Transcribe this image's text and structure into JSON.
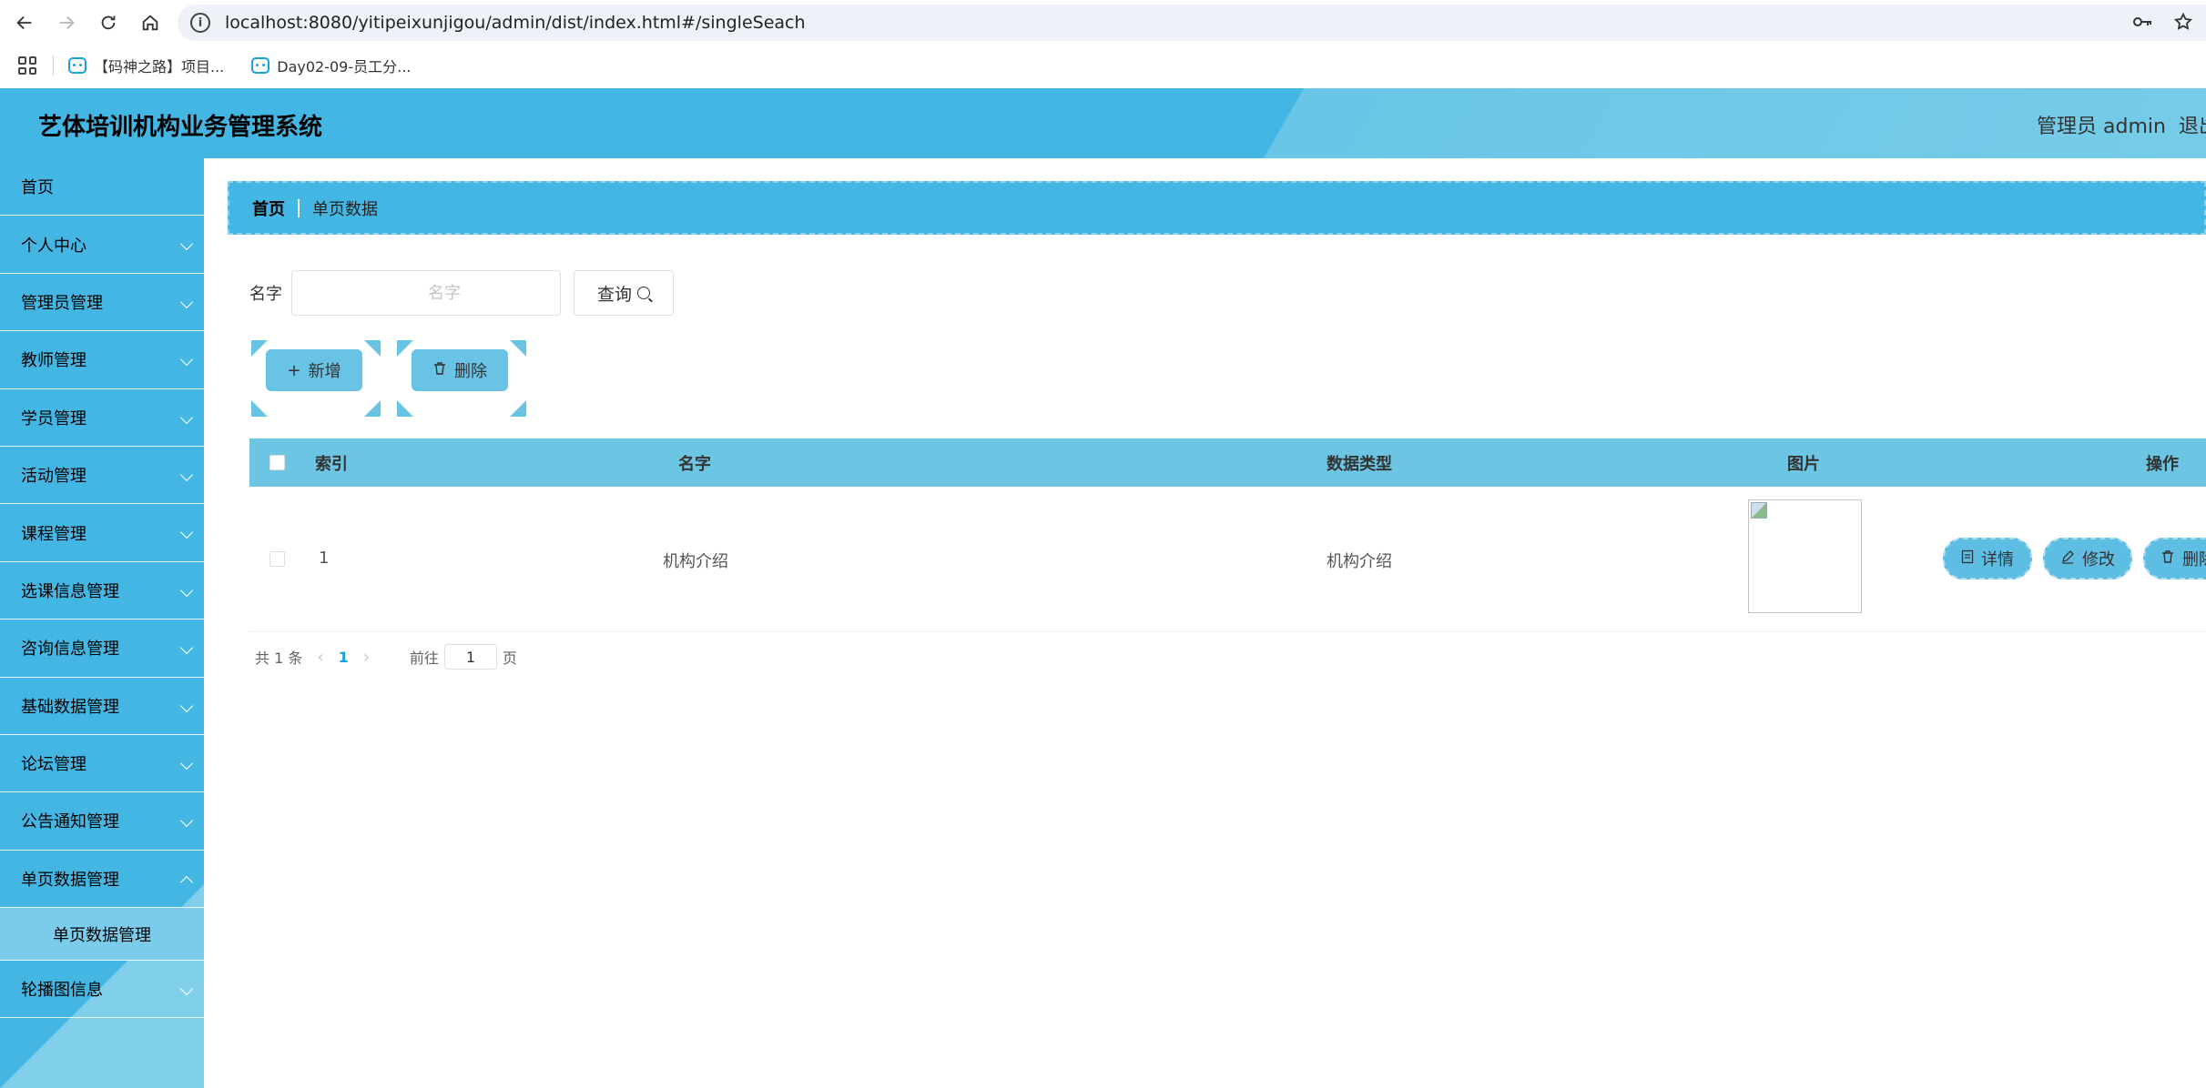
{
  "browser": {
    "url": "localhost:8080/yitipeixunjigou/admin/dist/index.html#/singleSeach",
    "bookmarks": [
      {
        "label": "【码神之路】项目..."
      },
      {
        "label": "Day02-09-员工分..."
      }
    ]
  },
  "header": {
    "title": "艺体培训机构业务管理系统",
    "user": "管理员 admin",
    "logout": "退出"
  },
  "sidebar": {
    "items": [
      {
        "label": "首页"
      },
      {
        "label": "个人中心"
      },
      {
        "label": "管理员管理"
      },
      {
        "label": "教师管理"
      },
      {
        "label": "学员管理"
      },
      {
        "label": "活动管理"
      },
      {
        "label": "课程管理"
      },
      {
        "label": "选课信息管理"
      },
      {
        "label": "咨询信息管理"
      },
      {
        "label": "基础数据管理"
      },
      {
        "label": "论坛管理"
      },
      {
        "label": "公告通知管理"
      },
      {
        "label": "单页数据管理"
      },
      {
        "label": "轮播图信息"
      }
    ],
    "submenu_label": "单页数据管理"
  },
  "breadcrumb": {
    "home": "首页",
    "current": "单页数据"
  },
  "search": {
    "label": "名字",
    "placeholder": "名字",
    "value": "",
    "button": "查询"
  },
  "actions": {
    "add": "新增",
    "delete": "删除"
  },
  "table": {
    "columns": [
      "索引",
      "名字",
      "数据类型",
      "图片",
      "操作"
    ],
    "rows": [
      {
        "index": "1",
        "name": "机构介绍",
        "type": "机构介绍"
      }
    ],
    "row_actions": {
      "detail": "详情",
      "edit": "修改",
      "delete": "删除"
    }
  },
  "pagination": {
    "total": "共 1 条",
    "current": "1",
    "goto_prefix": "前往",
    "goto_value": "1",
    "goto_suffix": "页"
  },
  "colors": {
    "primary": "#44b6e4",
    "table_header": "#6cc5e3"
  }
}
